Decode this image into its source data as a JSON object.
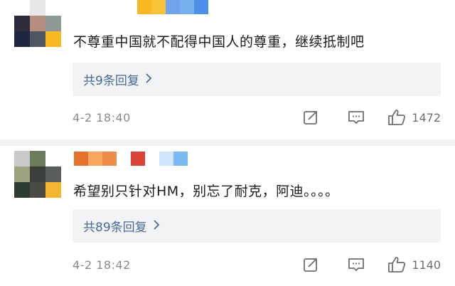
{
  "comments": [
    {
      "avatar_colors": [
        "#ffffff",
        "#e6e6e6",
        "#ffffff",
        "#2e2a3b",
        "#b58d7e",
        "#8d9a96",
        "#1d2540",
        "#4f5565",
        "#f7b821"
      ],
      "username_colors": [
        "#fbb722",
        "#f8c236",
        "#6fa4ec",
        "#76b1ee",
        "#4c8fe8"
      ],
      "text": "不尊重中国就不配得中国人的尊重，继续抵制吧",
      "replies_label": "共9条回复",
      "time": "4-2 18:40",
      "likes": "1472"
    },
    {
      "avatar_colors": [
        "#c9c9c9",
        "#6d7a5c",
        "#ffffff",
        "#9ca27e",
        "#3b3f3b",
        "#5a5f5c",
        "#2f3d30",
        "#474b44",
        "#f2b531"
      ],
      "username_colors": [
        "#e2732c",
        "#f6a65f",
        "#ef8c4b",
        "#ffffff",
        "#d9433a",
        "#ffffff",
        "#cfe5fb",
        "#7cb8f2"
      ],
      "text": "希望别只针对HM，别忘了耐克，阿迪。。。。",
      "replies_label": "共89条回复",
      "time": "4-2 18:42",
      "likes": "1140"
    }
  ],
  "icons": {
    "share": "share-icon",
    "comment": "comment-icon",
    "like": "thumbs-up-icon",
    "chevron": "chevron-right-icon"
  },
  "colors": {
    "reply_link": "#4a6a94",
    "reply_bg": "#f2f3f5",
    "meta_text": "#8a8a8a",
    "divider": "#f2f2f2"
  }
}
